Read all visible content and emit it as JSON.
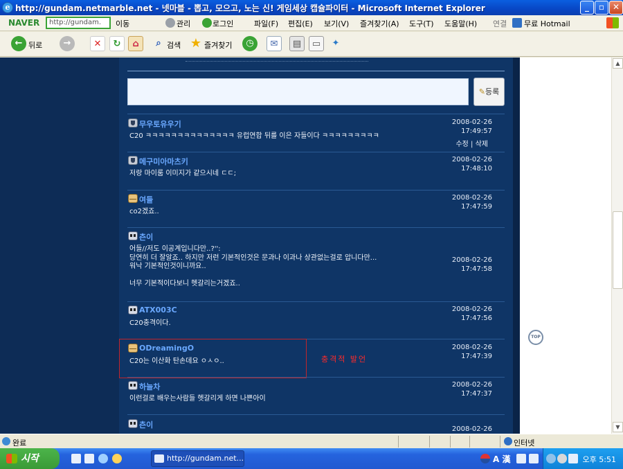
{
  "window": {
    "title": "http://gundam.netmarble.net - 넷마블 - 뽑고, 모으고, 노는 신! 게임세상 캡슐파이터 - Microsoft Internet Explorer",
    "min": "_",
    "max": "▫",
    "close": "✕"
  },
  "naverbar": {
    "brand": "NAVER",
    "address": "http://gundam.",
    "go": "이동",
    "manage": "관리",
    "login": "로그인",
    "menus": [
      "파일(F)",
      "편집(E)",
      "보기(V)",
      "즐겨찾기(A)",
      "도구(T)",
      "도움말(H)"
    ],
    "links": "연결",
    "hotmail": "무료 Hotmail"
  },
  "toolbar": {
    "back": "뒤로",
    "search": "검색",
    "favorites": "즐겨찾기"
  },
  "page": {
    "register_label": "등록",
    "top_label": "TOP",
    "highlight_note": "충격적 발언",
    "comments": [
      {
        "nick": "무우토유우기",
        "text": "C20 ㅋㅋㅋㅋㅋㅋㅋㅋㅋㅋㅋㅋㅋㅋ 유럽연합 뒤를 이은 자들이다 ㅋㅋㅋㅋㅋㅋㅋㅋㅋ",
        "date": "2008-02-26",
        "time": "17:49:57",
        "actions": "수정 | 삭제",
        "avatar": "shield"
      },
      {
        "nick": "메구미아마츠키",
        "text": "저랑 마이룸 이미지가 같으시네 ㄷㄷ;",
        "date": "2008-02-26",
        "time": "17:48:10",
        "avatar": "shield"
      },
      {
        "nick": "여들",
        "text": "co2겠죠..",
        "date": "2008-02-26",
        "time": "17:47:59",
        "avatar": "env"
      },
      {
        "nick": "츤이",
        "text": "어들//저도 이공계입니다만..?'':\n당연히 더 잘알죠.. 하지만 저런 기본적인것은 문과나 이과나 상관없는걸로 압니다만...\n워낙 기본적인것이니까요..\n\n너무 기본적이다보니 헷갈리는거겠죠..",
        "date": "2008-02-26",
        "time": "17:47:58",
        "avatar": "face"
      },
      {
        "nick": "ATX003C",
        "text": "C20충격이다.",
        "date": "2008-02-26",
        "time": "17:47:56",
        "avatar": "face"
      },
      {
        "nick": "ODreamingO",
        "text": "C20는 이산화 탄손데요 ㅇㅅㅇ..",
        "date": "2008-02-26",
        "time": "17:47:39",
        "avatar": "env"
      },
      {
        "nick": "하늘차",
        "text": "이런걸로 배우는사람들 헷갈리게 하면 나쁜아이",
        "date": "2008-02-26",
        "time": "17:47:37",
        "avatar": "face"
      },
      {
        "nick": "츤이",
        "text": "",
        "date": "2008-02-26",
        "time": "",
        "avatar": "face"
      }
    ]
  },
  "statusbar": {
    "status": "완료",
    "zone": "인터넷"
  },
  "taskbar": {
    "start": "시작",
    "task": "http://gundam.net...",
    "clock": "오후 5:51",
    "ime": "A 漢"
  }
}
